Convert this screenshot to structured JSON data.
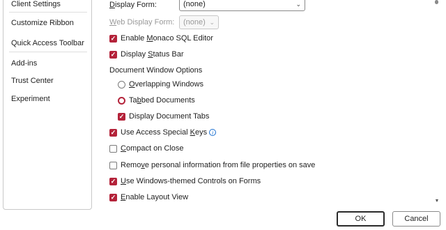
{
  "sidebar": {
    "items": [
      {
        "label": "Client Settings"
      },
      {
        "label": "Customize Ribbon"
      },
      {
        "label": "Quick Access Toolbar"
      },
      {
        "label": "Add-ins"
      },
      {
        "label": "Trust Center"
      },
      {
        "label": "Experiment"
      }
    ]
  },
  "main": {
    "display_form": {
      "label_a": "D",
      "label_b": "isplay Form:",
      "value": "(none)"
    },
    "web_display_form": {
      "label_a": "W",
      "label_b": "eb Display Form:",
      "value": "(none)"
    },
    "monaco": {
      "pre": "Enable ",
      "acc": "M",
      "post": "onaco SQL Editor",
      "checked": true
    },
    "status_bar": {
      "pre": "Display ",
      "acc": "S",
      "post": "tatus Bar",
      "checked": true
    },
    "doc_window_heading": "Document Window Options",
    "overlapping": {
      "pre": "",
      "acc": "O",
      "post": "verlapping Windows",
      "selected": false
    },
    "tabbed": {
      "pre": "Ta",
      "acc": "b",
      "post": "bed Documents",
      "selected": true
    },
    "doc_tabs": {
      "pre": "Display Document Tabs",
      "checked": true
    },
    "special_keys": {
      "pre": "Use Access Special ",
      "acc": "K",
      "post": "eys",
      "checked": true,
      "info_glyph": "i"
    },
    "compact": {
      "pre": "",
      "acc": "C",
      "post": "ompact on Close",
      "checked": false
    },
    "remove_personal": {
      "pre": "Remo",
      "acc": "v",
      "post": "e personal information from file properties on save",
      "checked": false
    },
    "windows_themed": {
      "pre": "",
      "acc": "U",
      "post": "se Windows-themed Controls on Forms",
      "checked": true
    },
    "layout_view": {
      "pre": "",
      "acc": "E",
      "post": "nable Layout View",
      "checked": true
    }
  },
  "buttons": {
    "ok": "OK",
    "cancel": "Cancel"
  },
  "colors": {
    "accent": "#b4233a",
    "info": "#1a6fd0"
  }
}
